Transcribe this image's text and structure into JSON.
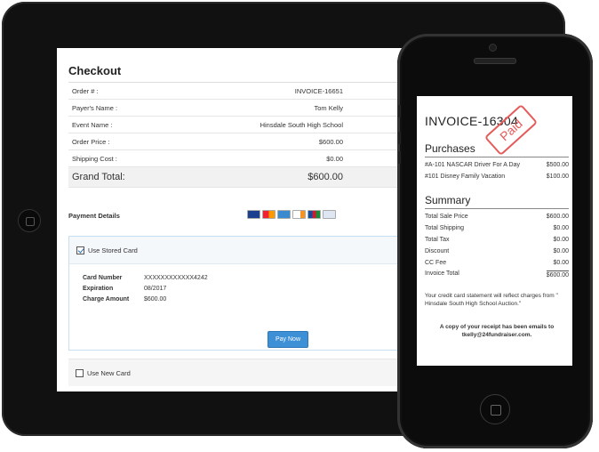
{
  "checkout": {
    "title": "Checkout",
    "rows": [
      {
        "label": "Order # :",
        "value": "INVOICE-16651"
      },
      {
        "label": "Payer's Name :",
        "value": "Tom Kelly"
      },
      {
        "label": "Event Name :",
        "value": "Hinsdale South High School"
      },
      {
        "label": "Order Price :",
        "value": "$600.00"
      },
      {
        "label": "Shipping Cost :",
        "value": "$0.00"
      }
    ],
    "grand_total_label": "Grand Total:",
    "grand_total_value": "$600.00",
    "payment_details_label": "Payment Details",
    "card_icons": [
      "visa-icon",
      "mastercard-icon",
      "amex-icon",
      "discover-icon",
      "jcb-icon",
      "diners-icon"
    ],
    "use_stored_card_label": "Use Stored Card",
    "stored_card_checked": true,
    "card_number_label": "Card Number",
    "card_number_value": "XXXXXXXXXXXX4242",
    "expiration_label": "Expiration",
    "expiration_value": "08/2017",
    "charge_amount_label": "Charge Amount",
    "charge_amount_value": "$600.00",
    "pay_now_label": "Pay Now",
    "use_new_card_label": "Use New Card",
    "new_card_checked": false
  },
  "receipt": {
    "invoice_title": "INVOICE-16304",
    "stamp": "Paid",
    "purchases_heading": "Purchases",
    "purchases": [
      {
        "item": "#A-101 NASCAR Driver For A Day",
        "price": "$500.00"
      },
      {
        "item": "#101 Disney Family Vacation",
        "price": "$100.00"
      }
    ],
    "summary_heading": "Summary",
    "summary": [
      {
        "label": "Total Sale Price",
        "value": "$600.00"
      },
      {
        "label": "Total Shipping",
        "value": "$0.00"
      },
      {
        "label": "Total Tax",
        "value": "$0.00"
      },
      {
        "label": "Discount",
        "value": "$0.00"
      },
      {
        "label": "CC Fee",
        "value": "$0.00"
      },
      {
        "label": "Invoice Total",
        "value": "$600.00"
      }
    ],
    "statement_note": "Your credit card statement will reflect charges from \" Hinsdale South High School Auction.\"",
    "email_note": "A copy of your receipt has been emails to tkelly@24fundraiser.com."
  },
  "colors": {
    "accent": "#3d8fd6",
    "stamp": "#e65a5a"
  }
}
